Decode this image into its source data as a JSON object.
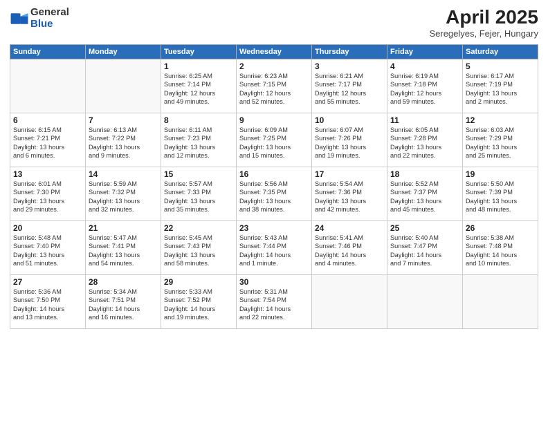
{
  "logo": {
    "general": "General",
    "blue": "Blue"
  },
  "title": "April 2025",
  "location": "Seregelyes, Fejer, Hungary",
  "headers": [
    "Sunday",
    "Monday",
    "Tuesday",
    "Wednesday",
    "Thursday",
    "Friday",
    "Saturday"
  ],
  "weeks": [
    [
      {
        "day": "",
        "info": ""
      },
      {
        "day": "",
        "info": ""
      },
      {
        "day": "1",
        "info": "Sunrise: 6:25 AM\nSunset: 7:14 PM\nDaylight: 12 hours\nand 49 minutes."
      },
      {
        "day": "2",
        "info": "Sunrise: 6:23 AM\nSunset: 7:15 PM\nDaylight: 12 hours\nand 52 minutes."
      },
      {
        "day": "3",
        "info": "Sunrise: 6:21 AM\nSunset: 7:17 PM\nDaylight: 12 hours\nand 55 minutes."
      },
      {
        "day": "4",
        "info": "Sunrise: 6:19 AM\nSunset: 7:18 PM\nDaylight: 12 hours\nand 59 minutes."
      },
      {
        "day": "5",
        "info": "Sunrise: 6:17 AM\nSunset: 7:19 PM\nDaylight: 13 hours\nand 2 minutes."
      }
    ],
    [
      {
        "day": "6",
        "info": "Sunrise: 6:15 AM\nSunset: 7:21 PM\nDaylight: 13 hours\nand 6 minutes."
      },
      {
        "day": "7",
        "info": "Sunrise: 6:13 AM\nSunset: 7:22 PM\nDaylight: 13 hours\nand 9 minutes."
      },
      {
        "day": "8",
        "info": "Sunrise: 6:11 AM\nSunset: 7:23 PM\nDaylight: 13 hours\nand 12 minutes."
      },
      {
        "day": "9",
        "info": "Sunrise: 6:09 AM\nSunset: 7:25 PM\nDaylight: 13 hours\nand 15 minutes."
      },
      {
        "day": "10",
        "info": "Sunrise: 6:07 AM\nSunset: 7:26 PM\nDaylight: 13 hours\nand 19 minutes."
      },
      {
        "day": "11",
        "info": "Sunrise: 6:05 AM\nSunset: 7:28 PM\nDaylight: 13 hours\nand 22 minutes."
      },
      {
        "day": "12",
        "info": "Sunrise: 6:03 AM\nSunset: 7:29 PM\nDaylight: 13 hours\nand 25 minutes."
      }
    ],
    [
      {
        "day": "13",
        "info": "Sunrise: 6:01 AM\nSunset: 7:30 PM\nDaylight: 13 hours\nand 29 minutes."
      },
      {
        "day": "14",
        "info": "Sunrise: 5:59 AM\nSunset: 7:32 PM\nDaylight: 13 hours\nand 32 minutes."
      },
      {
        "day": "15",
        "info": "Sunrise: 5:57 AM\nSunset: 7:33 PM\nDaylight: 13 hours\nand 35 minutes."
      },
      {
        "day": "16",
        "info": "Sunrise: 5:56 AM\nSunset: 7:35 PM\nDaylight: 13 hours\nand 38 minutes."
      },
      {
        "day": "17",
        "info": "Sunrise: 5:54 AM\nSunset: 7:36 PM\nDaylight: 13 hours\nand 42 minutes."
      },
      {
        "day": "18",
        "info": "Sunrise: 5:52 AM\nSunset: 7:37 PM\nDaylight: 13 hours\nand 45 minutes."
      },
      {
        "day": "19",
        "info": "Sunrise: 5:50 AM\nSunset: 7:39 PM\nDaylight: 13 hours\nand 48 minutes."
      }
    ],
    [
      {
        "day": "20",
        "info": "Sunrise: 5:48 AM\nSunset: 7:40 PM\nDaylight: 13 hours\nand 51 minutes."
      },
      {
        "day": "21",
        "info": "Sunrise: 5:47 AM\nSunset: 7:41 PM\nDaylight: 13 hours\nand 54 minutes."
      },
      {
        "day": "22",
        "info": "Sunrise: 5:45 AM\nSunset: 7:43 PM\nDaylight: 13 hours\nand 58 minutes."
      },
      {
        "day": "23",
        "info": "Sunrise: 5:43 AM\nSunset: 7:44 PM\nDaylight: 14 hours\nand 1 minute."
      },
      {
        "day": "24",
        "info": "Sunrise: 5:41 AM\nSunset: 7:46 PM\nDaylight: 14 hours\nand 4 minutes."
      },
      {
        "day": "25",
        "info": "Sunrise: 5:40 AM\nSunset: 7:47 PM\nDaylight: 14 hours\nand 7 minutes."
      },
      {
        "day": "26",
        "info": "Sunrise: 5:38 AM\nSunset: 7:48 PM\nDaylight: 14 hours\nand 10 minutes."
      }
    ],
    [
      {
        "day": "27",
        "info": "Sunrise: 5:36 AM\nSunset: 7:50 PM\nDaylight: 14 hours\nand 13 minutes."
      },
      {
        "day": "28",
        "info": "Sunrise: 5:34 AM\nSunset: 7:51 PM\nDaylight: 14 hours\nand 16 minutes."
      },
      {
        "day": "29",
        "info": "Sunrise: 5:33 AM\nSunset: 7:52 PM\nDaylight: 14 hours\nand 19 minutes."
      },
      {
        "day": "30",
        "info": "Sunrise: 5:31 AM\nSunset: 7:54 PM\nDaylight: 14 hours\nand 22 minutes."
      },
      {
        "day": "",
        "info": ""
      },
      {
        "day": "",
        "info": ""
      },
      {
        "day": "",
        "info": ""
      }
    ]
  ]
}
